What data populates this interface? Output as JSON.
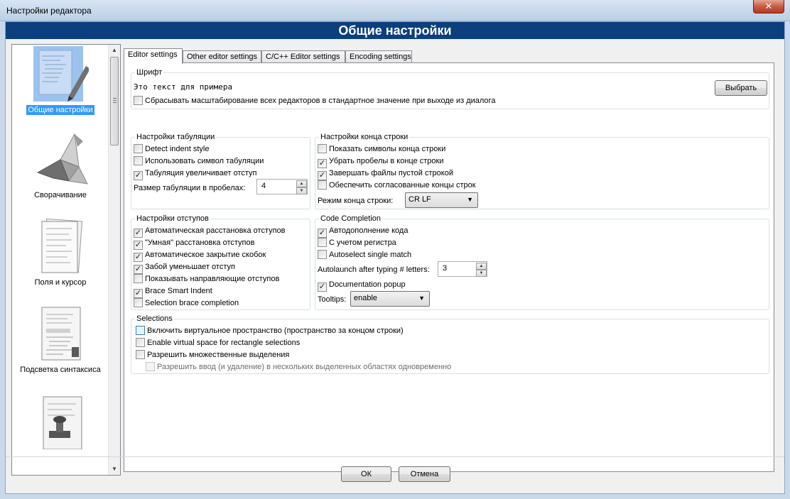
{
  "window": {
    "title": "Настройки редактора",
    "close_glyph": "✕"
  },
  "header": {
    "title": "Общие настройки"
  },
  "categories": [
    {
      "label": "Общие настройки",
      "icon": "editor-page-icon"
    },
    {
      "label": "Сворачивание",
      "icon": "origami-bird-icon"
    },
    {
      "label": "Поля и курсор",
      "icon": "pages-stack-icon"
    },
    {
      "label": "Подсветка синтаксиса",
      "icon": "highlighted-page-icon"
    },
    {
      "label": "",
      "icon": "stamp-page-icon"
    }
  ],
  "tabs": [
    "Editor settings",
    "Other editor settings",
    "C/C++ Editor settings",
    "Encoding settings"
  ],
  "font_group": {
    "legend": "Шрифт",
    "sample": "Это текст для примера",
    "choose_button": "Выбрать",
    "reset_zoom": {
      "label": "Сбрасывать масштабирование всех редакторов в стандартное значение при выходе из диалога",
      "checked": false
    }
  },
  "tab_group": {
    "legend": "Настройки табуляции",
    "items": [
      {
        "label": "Detect indent style",
        "checked": false
      },
      {
        "label": "Использовать символ табуляции",
        "checked": false
      },
      {
        "label": "Табуляция увеличивает отступ",
        "checked": true
      }
    ],
    "tab_size_label": "Размер табуляции в пробелах:",
    "tab_size_value": "4"
  },
  "eol_group": {
    "legend": "Настройки конца строки",
    "items": [
      {
        "label": "Показать символы конца строки",
        "checked": false
      },
      {
        "label": "Убрать пробелы в конце строки",
        "checked": true
      },
      {
        "label": "Завершать файлы пустой строкой",
        "checked": true
      },
      {
        "label": "Обеспечить согласованные концы строк",
        "checked": false
      }
    ],
    "mode_label": "Режим конца строки:",
    "mode_value": "CR LF"
  },
  "indent_group": {
    "legend": "Настройки отступов",
    "items": [
      {
        "label": "Автоматическая расстановка отступов",
        "checked": true
      },
      {
        "label": "\"Умная\" расстановка отступов",
        "checked": true
      },
      {
        "label": "Автоматическое закрытие скобок",
        "checked": true
      },
      {
        "label": "Забой уменьшает отступ",
        "checked": true
      },
      {
        "label": "Показывать направляющие отступов",
        "checked": false
      },
      {
        "label": "Brace Smart Indent",
        "checked": true
      },
      {
        "label": "Selection brace completion",
        "checked": false
      }
    ]
  },
  "completion_group": {
    "legend": "Code Completion",
    "items": [
      {
        "label": "Автодополнение кода",
        "checked": true
      },
      {
        "label": "С учетом регистра",
        "checked": false
      },
      {
        "label": "Autoselect single match",
        "checked": false
      }
    ],
    "autolaunch_label": "Autolaunch after typing # letters:",
    "autolaunch_value": "3",
    "doc_popup": {
      "label": "Documentation popup",
      "checked": true
    },
    "tooltips_label": "Tooltips:",
    "tooltips_value": "enable"
  },
  "selections_group": {
    "legend": "Selections",
    "items": [
      {
        "label": "Включить виртуальное пространство (пространство за концом строки)",
        "checked": false
      },
      {
        "label": "Enable virtual space for rectangle selections",
        "checked": false
      },
      {
        "label": "Разрешить множественные выделения",
        "checked": false
      },
      {
        "label": "Разрешить ввод (и удаление) в нескольких выделенных областях одновременно",
        "checked": false,
        "disabled": true
      }
    ]
  },
  "buttons": {
    "ok": "ОК",
    "cancel": "Отмена"
  },
  "check_glyph": "✓"
}
